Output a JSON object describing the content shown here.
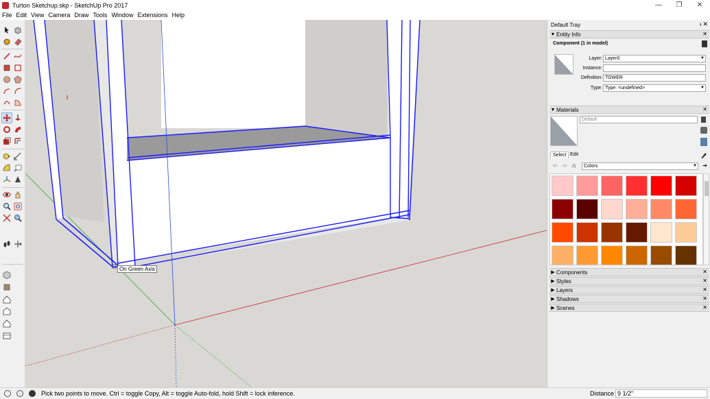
{
  "window": {
    "title": "Turton Sketchup.skp - SketchUp Pro 2017",
    "minimize": "—",
    "maximize": "❐",
    "close": "✕"
  },
  "menu": [
    "File",
    "Edit",
    "View",
    "Camera",
    "Draw",
    "Tools",
    "Window",
    "Extensions",
    "Help"
  ],
  "viewport": {
    "tooltip": "On Green Axis"
  },
  "tray": {
    "title": "Default Tray",
    "entity_info": {
      "header": "Entity Info",
      "summary": "Component (1 in model)",
      "layer_label": "Layer:",
      "layer_value": "Layer0",
      "instance_label": "Instance:",
      "instance_value": "",
      "definition_label": "Definition:",
      "definition_value": "TOWER",
      "type_label": "Type:",
      "type_value": "Type: <undefined>"
    },
    "materials": {
      "header": "Materials",
      "material_name": "Default",
      "tab_select": "Select",
      "tab_edit": "Edit",
      "library": "Colors",
      "swatches": [
        "#ffc9c9",
        "#ff9b9b",
        "#ff6464",
        "#ff3030",
        "#ff0000",
        "#d40000",
        "#8c0000",
        "#5a0000",
        "#ffd7cf",
        "#ffae98",
        "#ff8a66",
        "#ff6633",
        "#ff4a00",
        "#cc3300",
        "#993300",
        "#661800",
        "#ffe6cc",
        "#ffcc99",
        "#ffb066",
        "#ff9a33",
        "#ff8800",
        "#cc6600",
        "#994c00",
        "#663300"
      ]
    },
    "collapsed_panels": [
      "Components",
      "Styles",
      "Layers",
      "Shadows",
      "Scenes"
    ]
  },
  "status": {
    "hint": "Pick two points to move.  Ctrl = toggle Copy, Alt = toggle Auto-fold, hold Shift = lock inference.",
    "measure_label": "Distance",
    "measure_value": "9 1/2\""
  },
  "colors": {
    "selection_blue": "#1a1aff",
    "axis_red": "#cc2b2b",
    "axis_green": "#3aa63a",
    "viewport_bg": "#d9d8d4"
  }
}
